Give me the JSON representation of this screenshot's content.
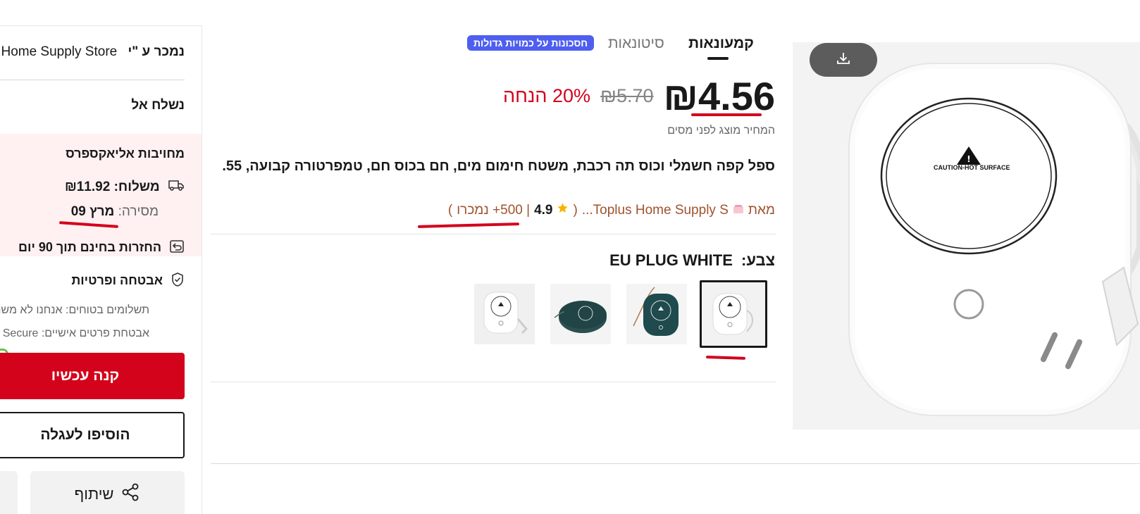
{
  "side": {
    "sold_by_label": "נמכר ע \"י",
    "sold_by_store": "Home Supply Store",
    "ship_to": "נשלח אל",
    "commitments": "מחויבות אליאקספרס",
    "shipping_label": "משלוח:",
    "shipping_price": "₪11.92",
    "delivery_label": "מסירה:",
    "delivery_date": "מרץ 09",
    "returns": "החזרות בחינם תוך 90 יום",
    "security": "אבטחה ופרטיות",
    "secure_payments": "תשלומים בטוחים: אנחנו לא משת",
    "personal_data": "אבטחת פרטים אישיים: Secure",
    "buy_now": "קנה עכשיו",
    "add_to_cart": "הוסיפו לעגלה",
    "share": "שיתוף"
  },
  "tabs": {
    "coupons": "קמעונאות",
    "wholesale": "סיטונאות",
    "bulk_badge": "חסכונות על כמויות גדולות"
  },
  "price": {
    "current": "₪4.56",
    "original": "₪5.70",
    "discount": "20% הנחה",
    "tax_note": "המחיר מוצג לפני מסים"
  },
  "product": {
    "title": "ספל קפה חשמלי וכוס תה רכבת, משטח חימום מים, חם בכוס חם, טמפרטורה קבועה, 55.",
    "from_label": "מאת",
    "store_name": "Toplus Home Supply S...",
    "rating": "4.9",
    "sold": "| 500+ נמכרו",
    "color_label": "צבע:",
    "color_value": "EU PLUG WHITE"
  },
  "image": {
    "caution_text": "CAUTION-HOT SURFACE"
  },
  "colors": {
    "accent_red": "#d3031c",
    "bulk_badge": "#4e5ff0",
    "store_brown": "#a0522d"
  }
}
